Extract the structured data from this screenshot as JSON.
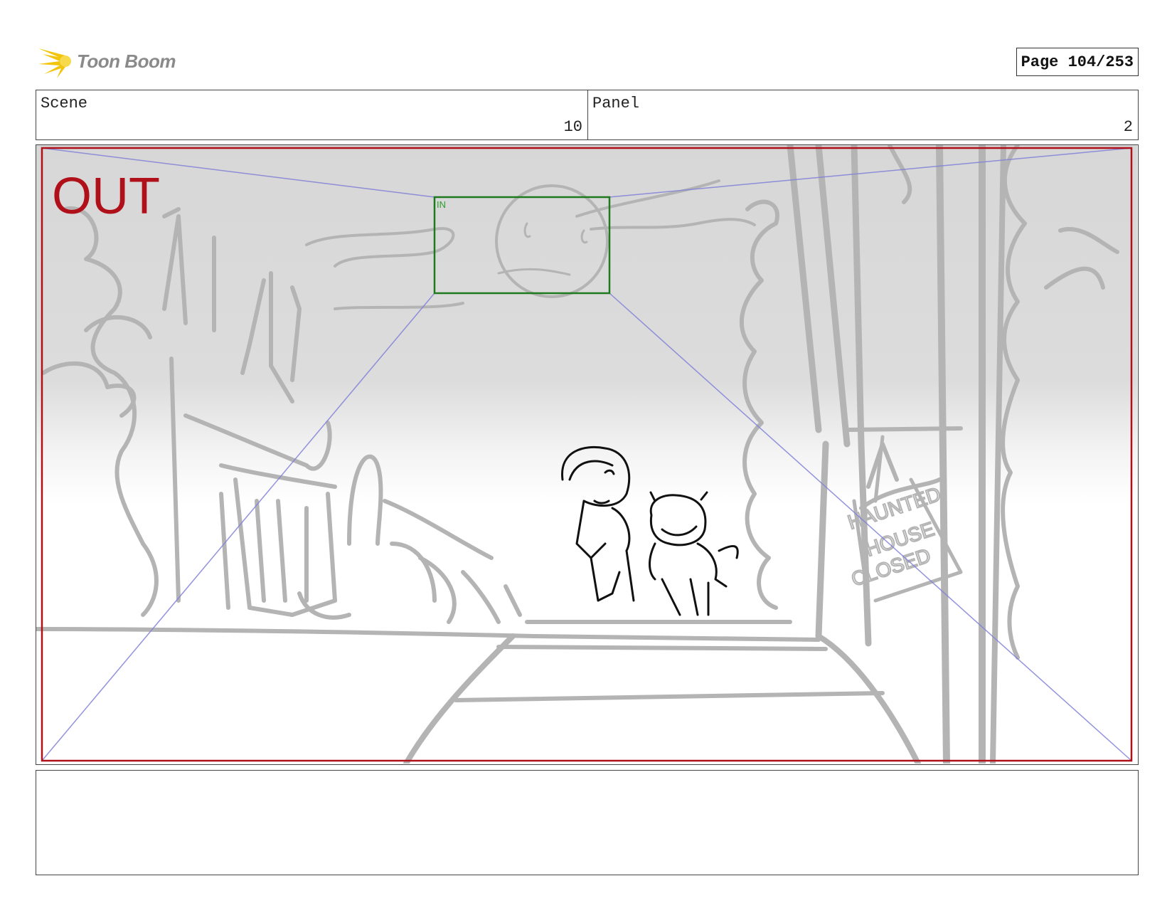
{
  "header": {
    "logo_text": "Toon Boom",
    "page_label": "Page 104/253"
  },
  "info": {
    "scene_label": "Scene",
    "scene_value": "10",
    "panel_label": "Panel",
    "panel_value": "2"
  },
  "panel_image": {
    "out_label": "OUT",
    "in_label": "IN",
    "sign_lines": [
      "HAUNTED",
      "HOUSE",
      "CLOSED"
    ]
  },
  "colors": {
    "out_frame": "#b0101a",
    "in_frame": "#1f7a1f",
    "perspective_lines": "#8080d8",
    "sketch_gray": "#b4b4b4",
    "character_ink": "#111111",
    "logo_flare": "#f2c40c"
  },
  "notes": ""
}
